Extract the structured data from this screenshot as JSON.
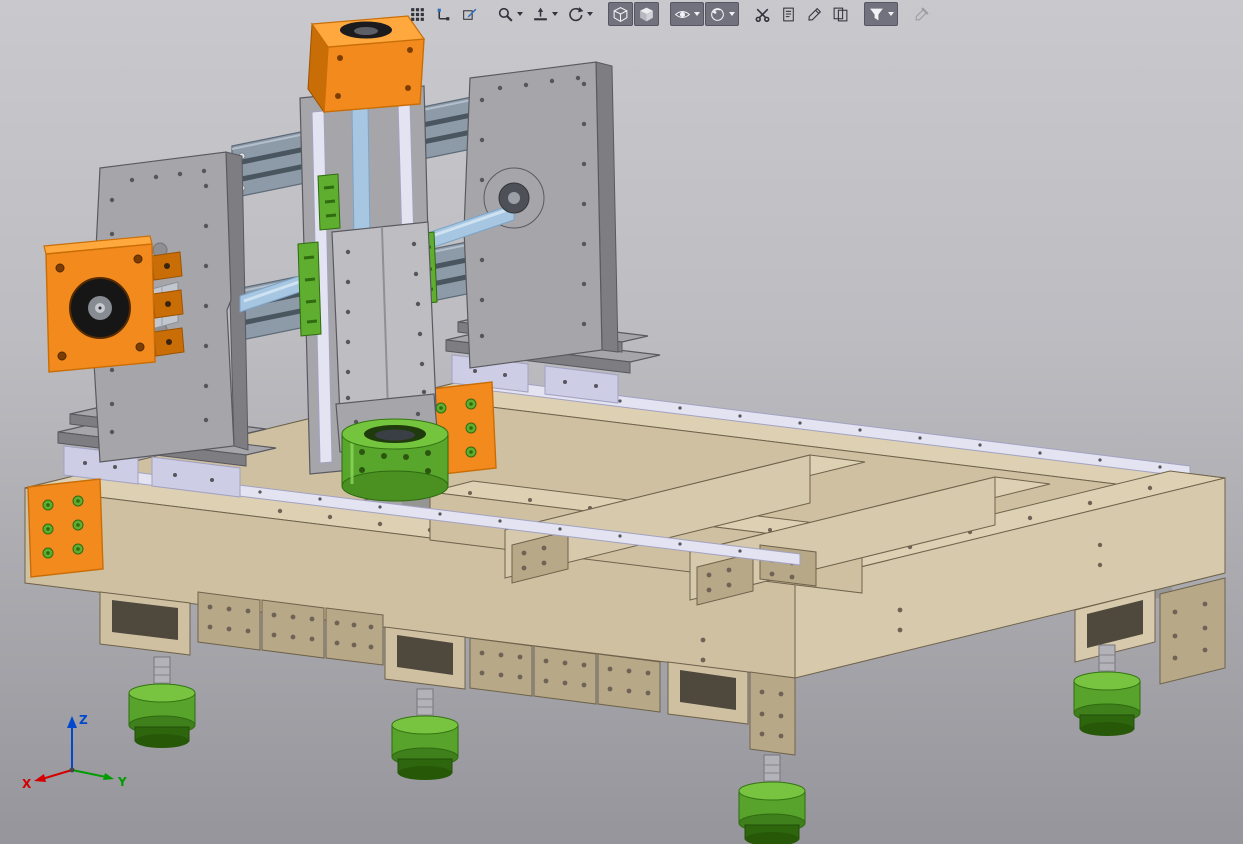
{
  "app": {
    "type": "cad-3d-viewport"
  },
  "toolbar": {
    "items": [
      {
        "name": "selection-filter-grid",
        "icon": "grid-icon"
      },
      {
        "name": "sketch",
        "icon": "sketch-icon"
      },
      {
        "name": "sketch-plane",
        "icon": "plane-icon"
      },
      {
        "name": "zoom",
        "icon": "zoom-icon",
        "dropdown": true,
        "gap": true
      },
      {
        "name": "normal-to",
        "icon": "normal-to-icon",
        "dropdown": true
      },
      {
        "name": "rotate-view",
        "icon": "rotate-icon",
        "dropdown": true
      },
      {
        "name": "view-orientation",
        "icon": "cube-icon",
        "pressed": true,
        "gap": true
      },
      {
        "name": "display-style",
        "icon": "shaded-cube-icon",
        "pressed": true
      },
      {
        "name": "hide-show-items",
        "icon": "eye-icon",
        "dropdown": true,
        "pressed": true,
        "gap": true
      },
      {
        "name": "appearances",
        "icon": "appearance-icon",
        "dropdown": true,
        "pressed": true
      },
      {
        "name": "section-view",
        "icon": "section-icon",
        "gap": true
      },
      {
        "name": "annotations",
        "icon": "annotation-icon"
      },
      {
        "name": "markup",
        "icon": "markup-icon"
      },
      {
        "name": "compare",
        "icon": "compare-icon"
      },
      {
        "name": "display-filter",
        "icon": "filter-icon",
        "dropdown": true,
        "pressed": true,
        "gap": true
      },
      {
        "name": "eyedropper",
        "icon": "eyedropper-icon",
        "disabled": true,
        "gap": true
      }
    ]
  },
  "triad": {
    "x_label": "X",
    "y_label": "Y",
    "z_label": "Z"
  },
  "model": {
    "name": "cnc-router-assembly",
    "parts": [
      "base-frame",
      "leveling-feet",
      "linear-rails",
      "rail-carriages",
      "corner-brackets",
      "gantry-left-upright",
      "gantry-right-upright",
      "gantry-crossbeams",
      "ballscrew-shaft",
      "z-axis-carriage",
      "spindle-clamp",
      "stepper-motor-mount-top",
      "stepper-motor-mount-left",
      "frame-end-plates"
    ]
  },
  "colors": {
    "bg_top": "#c9c9cd",
    "bg_bottom": "#95959b",
    "tan_top": "#ddd0b3",
    "tan_face": "#cfc0a2",
    "tan_face2": "#d7c9ab",
    "tan_side": "#b7a888",
    "tan_dark": "#8d7f63",
    "tan_line": "#6f634c",
    "orange": "#f28a1d",
    "orange_dark": "#c96d06",
    "orange_light": "#ffa83e",
    "green": "#5fae2f",
    "green_dark": "#4a9122",
    "green_darker": "#2f6b10",
    "gray_face": "#a6a6aa",
    "gray_light": "#bebec2",
    "gray_dark": "#7d7d82",
    "gray_darker": "#595960",
    "steel": "#8d9aa8",
    "steel_dark": "#5d6a78",
    "steel_slot": "#49555f",
    "rail": "#e3e3f1",
    "rail_dark": "#a2a2c2",
    "carriage": "#cdcde6",
    "rod": "#a6c6e2",
    "rod_dark": "#7ca3c6",
    "axis_x": "#d40000",
    "axis_y": "#009c00",
    "axis_z": "#0049cf",
    "toolbar_icon": "#33333d",
    "toolbar_icon_disabled": "#9b9ba3",
    "toolbar_pressed_bg": "#72727e",
    "toolbar_pressed_border": "#565662"
  }
}
